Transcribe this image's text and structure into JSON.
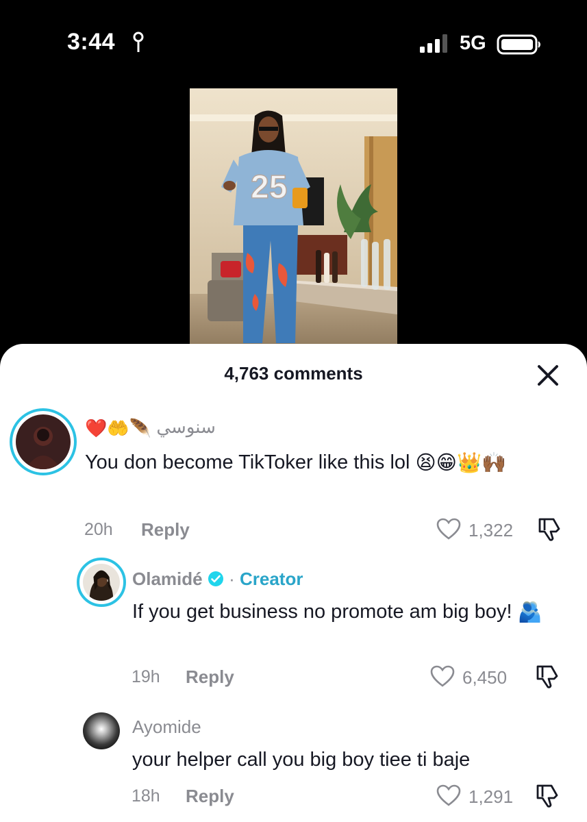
{
  "status_bar": {
    "time": "3:44",
    "network": "5G",
    "icons": [
      "location-icon",
      "signal-icon",
      "battery-icon"
    ]
  },
  "video": {
    "jersey_number": "25"
  },
  "comments_sheet": {
    "title": "4,763 comments",
    "close_icon": "close-icon",
    "comments": [
      {
        "username": "سنوسي",
        "username_emojis": "❤️🤲🪶",
        "text": "You don become TikToker like this lol",
        "text_emojis": "😫😁👑🙌🏾",
        "time": "20h",
        "reply_label": "Reply",
        "likes": "1,322"
      },
      {
        "username": "Olamidé",
        "badge": "verified-icon",
        "separator": "·",
        "creator_label": "Creator",
        "text": "If you get business no promote am big boy!",
        "text_emojis": "🫂",
        "time": "19h",
        "reply_label": "Reply",
        "likes": "6,450"
      },
      {
        "username": "Ayomide",
        "text": "your helper call you big boy tiee ti baje",
        "time": "18h",
        "reply_label": "Reply",
        "likes": "1,291"
      }
    ]
  },
  "colors": {
    "accent": "#2cc2e4",
    "creator": "#2aa5c9",
    "text": "#161823",
    "muted": "#8a8b91"
  }
}
